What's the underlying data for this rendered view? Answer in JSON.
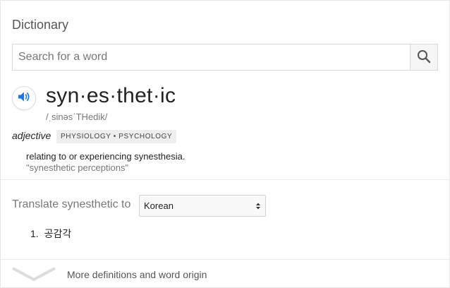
{
  "card": {
    "title": "Dictionary"
  },
  "search": {
    "placeholder": "Search for a word",
    "value": "",
    "icon": "search-icon"
  },
  "entry": {
    "word": "syn·es·thet·ic",
    "phonetic": "/ˌsinəsˈTHedik/",
    "pronounce_icon": "speaker-icon",
    "part_of_speech": "adjective",
    "labels": "PHYSIOLOGY • PSYCHOLOGY",
    "definition": "relating to or experiencing synesthesia.",
    "example": "\"synesthetic perceptions\""
  },
  "translate": {
    "label": "Translate synesthetic to",
    "selected_language": "Korean",
    "results": [
      {
        "number": "1.",
        "text": "공감각"
      }
    ]
  },
  "footer": {
    "more_label": "More definitions and word origin",
    "icon": "chevron-down-icon"
  },
  "colors": {
    "accent": "#1a73e8",
    "muted": "#777777",
    "tag_bg": "#eeeeee"
  }
}
